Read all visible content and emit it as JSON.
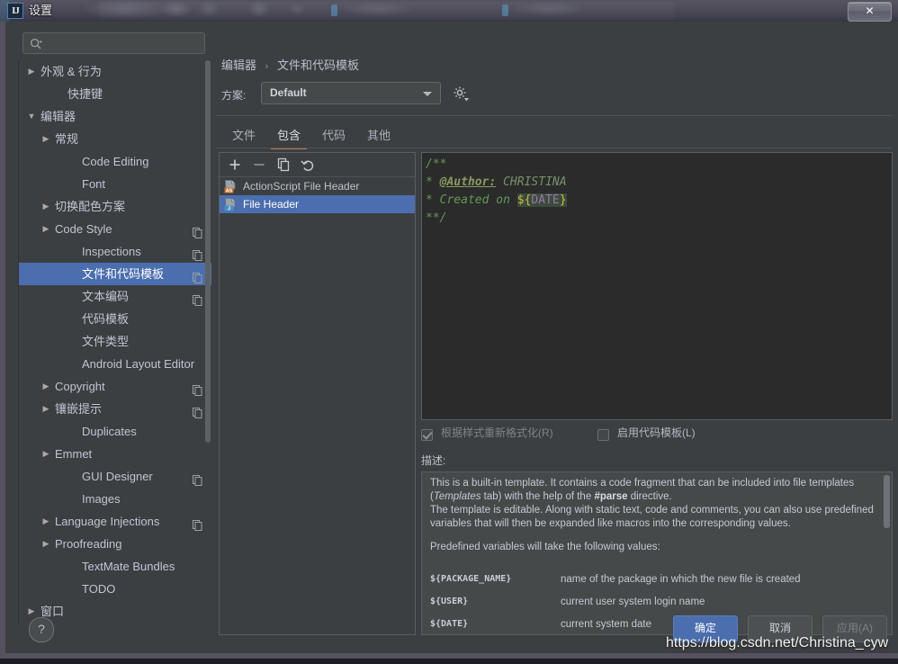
{
  "window": {
    "title": "设置",
    "app_icon": "IJ",
    "close_label": "✕"
  },
  "search": {
    "placeholder": "",
    "value": "",
    "icon": "search-icon"
  },
  "sidebar": {
    "items": [
      {
        "label": "外观 & 行为",
        "indent": 10,
        "arrow": "▶",
        "copy": false,
        "selected": false
      },
      {
        "label": "快捷键",
        "indent": 24,
        "arrow": "",
        "copy": false,
        "selected": false
      },
      {
        "label": "编辑器",
        "indent": 10,
        "arrow": "▼",
        "copy": false,
        "selected": false
      },
      {
        "label": "常规",
        "indent": 26,
        "arrow": "▶",
        "copy": false,
        "selected": false
      },
      {
        "label": "Code Editing",
        "indent": 40,
        "arrow": "",
        "copy": false,
        "selected": false
      },
      {
        "label": "Font",
        "indent": 40,
        "arrow": "",
        "copy": false,
        "selected": false
      },
      {
        "label": "切换配色方案",
        "indent": 26,
        "arrow": "▶",
        "copy": false,
        "selected": false
      },
      {
        "label": "Code Style",
        "indent": 26,
        "arrow": "▶",
        "copy": true,
        "selected": false
      },
      {
        "label": "Inspections",
        "indent": 40,
        "arrow": "",
        "copy": true,
        "selected": false
      },
      {
        "label": "文件和代码模板",
        "indent": 40,
        "arrow": "",
        "copy": true,
        "selected": true
      },
      {
        "label": "文本编码",
        "indent": 40,
        "arrow": "",
        "copy": true,
        "selected": false
      },
      {
        "label": "代码模板",
        "indent": 40,
        "arrow": "",
        "copy": false,
        "selected": false
      },
      {
        "label": "文件类型",
        "indent": 40,
        "arrow": "",
        "copy": false,
        "selected": false
      },
      {
        "label": "Android Layout Editor",
        "indent": 40,
        "arrow": "",
        "copy": false,
        "selected": false
      },
      {
        "label": "Copyright",
        "indent": 26,
        "arrow": "▶",
        "copy": true,
        "selected": false
      },
      {
        "label": "镶嵌提示",
        "indent": 26,
        "arrow": "▶",
        "copy": true,
        "selected": false
      },
      {
        "label": "Duplicates",
        "indent": 40,
        "arrow": "",
        "copy": false,
        "selected": false
      },
      {
        "label": "Emmet",
        "indent": 26,
        "arrow": "▶",
        "copy": false,
        "selected": false
      },
      {
        "label": "GUI Designer",
        "indent": 40,
        "arrow": "",
        "copy": true,
        "selected": false
      },
      {
        "label": "Images",
        "indent": 40,
        "arrow": "",
        "copy": false,
        "selected": false
      },
      {
        "label": "Language Injections",
        "indent": 26,
        "arrow": "▶",
        "copy": true,
        "selected": false
      },
      {
        "label": "Proofreading",
        "indent": 26,
        "arrow": "▶",
        "copy": false,
        "selected": false
      },
      {
        "label": "TextMate Bundles",
        "indent": 40,
        "arrow": "",
        "copy": false,
        "selected": false
      },
      {
        "label": "TODO",
        "indent": 40,
        "arrow": "",
        "copy": false,
        "selected": false
      },
      {
        "label": "窗口",
        "indent": 10,
        "arrow": "▶",
        "copy": false,
        "selected": false
      }
    ]
  },
  "main": {
    "breadcrumb": {
      "parent": "编辑器",
      "separator": "›",
      "current": "文件和代码模板"
    },
    "scheme": {
      "label": "方案:",
      "value": "Default",
      "gear_icon": "gear-icon"
    },
    "tabs": [
      {
        "label": "文件",
        "active": false
      },
      {
        "label": "包含",
        "active": true
      },
      {
        "label": "代码",
        "active": false
      },
      {
        "label": "其他",
        "active": false
      }
    ],
    "toolbar": [
      {
        "name": "add-template-button",
        "glyph": "+"
      },
      {
        "name": "remove-template-button",
        "glyph": "−"
      },
      {
        "name": "copy-template-button",
        "glyph": "copy"
      },
      {
        "name": "reset-template-button",
        "glyph": "revert"
      }
    ],
    "templates": [
      {
        "label": "ActionScript File Header",
        "badge": "AS",
        "badge_color": "#cc7832",
        "selected": false
      },
      {
        "label": "File Header",
        "badge": "J",
        "badge_color": "#4a90c4",
        "selected": true
      }
    ],
    "editor": {
      "lines": [
        "/**",
        " * @Author: CHRISTINA",
        " * Created on ${DATE}",
        " **/"
      ],
      "author_tag": "@Author:",
      "author_value": "CHRISTINA",
      "date_variable": "${DATE}"
    },
    "checkboxes": [
      {
        "label": "根据样式重新格式化(R)",
        "checked": true,
        "disabled": true
      },
      {
        "label": "启用代码模板(L)",
        "checked": false,
        "disabled": false
      }
    ],
    "description": {
      "title": "描述:",
      "paragraph1_a": "This is a built-in template. It contains a code fragment that can be included into file templates (",
      "paragraph1_italic": "Templates",
      "paragraph1_b": " tab) with the help of the ",
      "paragraph1_bold": "#parse",
      "paragraph1_c": " directive.",
      "paragraph2": "The template is editable. Along with static text, code and comments, you can also use predefined variables that will then be expanded like macros into the corresponding values.",
      "paragraph3": "Predefined variables will take the following values:",
      "variables": [
        {
          "name": "${PACKAGE_NAME}",
          "desc": "name of the package in which the new file is created"
        },
        {
          "name": "${USER}",
          "desc": "current user system login name"
        },
        {
          "name": "${DATE}",
          "desc": "current system date"
        }
      ]
    }
  },
  "footer": {
    "help_label": "?",
    "ok_label": "确定",
    "cancel_label": "取消",
    "apply_label": "应用(A)",
    "apply_disabled": true
  },
  "watermark": "https://blog.csdn.net/Christina_cyw",
  "colors": {
    "selection_blue": "#4b6eaf",
    "panel_bg": "#3c3f41",
    "editor_bg": "#2b2b2b",
    "comment_green": "#629755",
    "tab_accent": "#a5825a"
  }
}
